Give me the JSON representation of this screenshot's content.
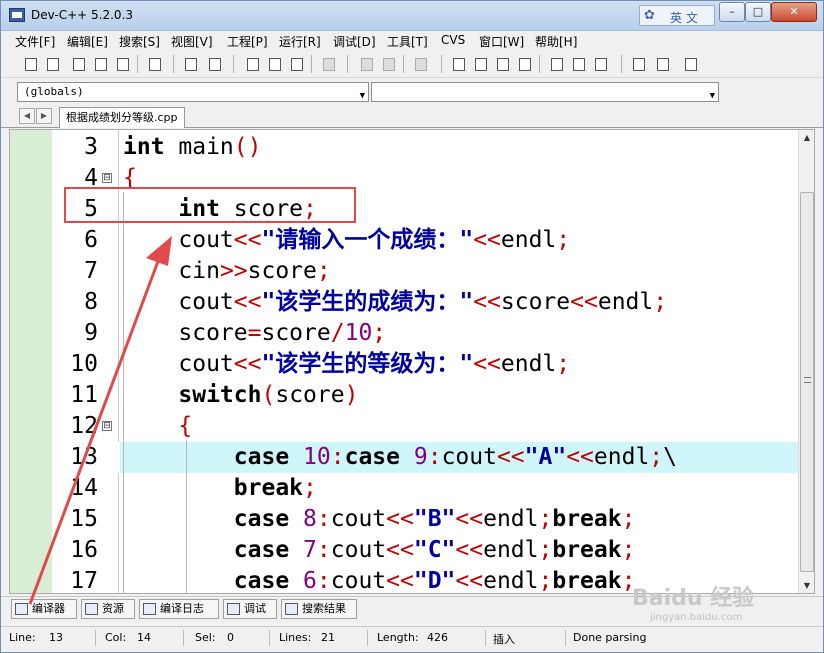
{
  "window": {
    "title": "Dev-C++ 5.2.0.3",
    "ime_label": "英 文",
    "controls": {
      "minimize": "–",
      "maximize": "□",
      "close": "✕"
    }
  },
  "menu": [
    "文件[F]",
    "编辑[E]",
    "搜索[S]",
    "视图[V]",
    "工程[P]",
    "运行[R]",
    "调试[D]",
    "工具[T]",
    "CVS",
    "窗口[W]",
    "帮助[H]"
  ],
  "toolbar": {
    "icons": [
      "new-file-icon",
      "open-file-icon",
      "save-icon",
      "save-all-icon",
      "close-file-icon",
      "print-icon",
      "undo-icon",
      "redo-icon",
      "find-icon",
      "replace-icon",
      "find-next-icon",
      "goto-line-icon",
      "add-to-project-icon",
      "remove-from-project-icon",
      "project-options-icon",
      "compile-icon",
      "run-icon",
      "compile-run-icon",
      "rebuild-icon",
      "syntax-check-icon",
      "profile-icon",
      "delete-profile-icon",
      "new-class-icon",
      "insert-icon",
      "toggle-bookmark-icon"
    ]
  },
  "combos": {
    "scope": "(globals)",
    "member": ""
  },
  "tabs": {
    "active_file": "根据成绩划分等级.cpp"
  },
  "editor": {
    "highlighted_line": "13",
    "lines": [
      {
        "num": "3",
        "fold": "",
        "code": [
          {
            "t": "int",
            "c": "kw"
          },
          {
            "t": " main",
            "c": ""
          },
          {
            "t": "()",
            "c": "op"
          }
        ]
      },
      {
        "num": "4",
        "fold": "⊟",
        "code": [
          {
            "t": "{",
            "c": "op"
          }
        ]
      },
      {
        "num": "5",
        "fold": "",
        "code": [
          {
            "t": "    ",
            "c": ""
          },
          {
            "t": "int",
            "c": "kw"
          },
          {
            "t": " score",
            "c": ""
          },
          {
            "t": ";",
            "c": "op"
          }
        ]
      },
      {
        "num": "6",
        "fold": "",
        "code": [
          {
            "t": "    cout",
            "c": ""
          },
          {
            "t": "<<",
            "c": "op"
          },
          {
            "t": "\"请输入一个成绩：\"",
            "c": "str"
          },
          {
            "t": "<<",
            "c": "op"
          },
          {
            "t": "endl",
            "c": ""
          },
          {
            "t": ";",
            "c": "op"
          }
        ]
      },
      {
        "num": "7",
        "fold": "",
        "code": [
          {
            "t": "    cin",
            "c": ""
          },
          {
            "t": ">>",
            "c": "op"
          },
          {
            "t": "score",
            "c": ""
          },
          {
            "t": ";",
            "c": "op"
          }
        ]
      },
      {
        "num": "8",
        "fold": "",
        "code": [
          {
            "t": "    cout",
            "c": ""
          },
          {
            "t": "<<",
            "c": "op"
          },
          {
            "t": "\"该学生的成绩为：\"",
            "c": "str"
          },
          {
            "t": "<<",
            "c": "op"
          },
          {
            "t": "score",
            "c": ""
          },
          {
            "t": "<<",
            "c": "op"
          },
          {
            "t": "endl",
            "c": ""
          },
          {
            "t": ";",
            "c": "op"
          }
        ]
      },
      {
        "num": "9",
        "fold": "",
        "code": [
          {
            "t": "    score",
            "c": ""
          },
          {
            "t": "=",
            "c": "op"
          },
          {
            "t": "score",
            "c": ""
          },
          {
            "t": "/",
            "c": "op"
          },
          {
            "t": "10",
            "c": "num"
          },
          {
            "t": ";",
            "c": "op"
          }
        ]
      },
      {
        "num": "10",
        "fold": "",
        "code": [
          {
            "t": "    cout",
            "c": ""
          },
          {
            "t": "<<",
            "c": "op"
          },
          {
            "t": "\"该学生的等级为：\"",
            "c": "str"
          },
          {
            "t": "<<",
            "c": "op"
          },
          {
            "t": "endl",
            "c": ""
          },
          {
            "t": ";",
            "c": "op"
          }
        ]
      },
      {
        "num": "11",
        "fold": "",
        "code": [
          {
            "t": "    ",
            "c": ""
          },
          {
            "t": "switch",
            "c": "kw"
          },
          {
            "t": "(",
            "c": "op"
          },
          {
            "t": "score",
            "c": ""
          },
          {
            "t": ")",
            "c": "op"
          }
        ]
      },
      {
        "num": "12",
        "fold": "⊟",
        "code": [
          {
            "t": "    ",
            "c": ""
          },
          {
            "t": "{",
            "c": "op"
          }
        ]
      },
      {
        "num": "13",
        "fold": "",
        "code": [
          {
            "t": "        ",
            "c": ""
          },
          {
            "t": "case",
            "c": "kw"
          },
          {
            "t": " ",
            "c": ""
          },
          {
            "t": "10",
            "c": "num"
          },
          {
            "t": ":",
            "c": "op"
          },
          {
            "t": "case",
            "c": "kw"
          },
          {
            "t": " ",
            "c": ""
          },
          {
            "t": "9",
            "c": "num"
          },
          {
            "t": ":",
            "c": "op"
          },
          {
            "t": "cout",
            "c": ""
          },
          {
            "t": "<<",
            "c": "op"
          },
          {
            "t": "\"A\"",
            "c": "str"
          },
          {
            "t": "<<",
            "c": "op"
          },
          {
            "t": "endl",
            "c": ""
          },
          {
            "t": ";",
            "c": "op"
          },
          {
            "t": "\\",
            "c": ""
          }
        ]
      },
      {
        "num": "14",
        "fold": "",
        "code": [
          {
            "t": "        ",
            "c": ""
          },
          {
            "t": "break",
            "c": "kw"
          },
          {
            "t": ";",
            "c": "op"
          }
        ]
      },
      {
        "num": "15",
        "fold": "",
        "code": [
          {
            "t": "        ",
            "c": ""
          },
          {
            "t": "case",
            "c": "kw"
          },
          {
            "t": " ",
            "c": ""
          },
          {
            "t": "8",
            "c": "num"
          },
          {
            "t": ":",
            "c": "op"
          },
          {
            "t": "cout",
            "c": ""
          },
          {
            "t": "<<",
            "c": "op"
          },
          {
            "t": "\"B\"",
            "c": "str"
          },
          {
            "t": "<<",
            "c": "op"
          },
          {
            "t": "endl",
            "c": ""
          },
          {
            "t": ";",
            "c": "op"
          },
          {
            "t": "break",
            "c": "kw"
          },
          {
            "t": ";",
            "c": "op"
          }
        ]
      },
      {
        "num": "16",
        "fold": "",
        "code": [
          {
            "t": "        ",
            "c": ""
          },
          {
            "t": "case",
            "c": "kw"
          },
          {
            "t": " ",
            "c": ""
          },
          {
            "t": "7",
            "c": "num"
          },
          {
            "t": ":",
            "c": "op"
          },
          {
            "t": "cout",
            "c": ""
          },
          {
            "t": "<<",
            "c": "op"
          },
          {
            "t": "\"C\"",
            "c": "str"
          },
          {
            "t": "<<",
            "c": "op"
          },
          {
            "t": "endl",
            "c": ""
          },
          {
            "t": ";",
            "c": "op"
          },
          {
            "t": "break",
            "c": "kw"
          },
          {
            "t": ";",
            "c": "op"
          }
        ]
      },
      {
        "num": "17",
        "fold": "",
        "code": [
          {
            "t": "        ",
            "c": ""
          },
          {
            "t": "case",
            "c": "kw"
          },
          {
            "t": " ",
            "c": ""
          },
          {
            "t": "6",
            "c": "num"
          },
          {
            "t": ":",
            "c": "op"
          },
          {
            "t": "cout",
            "c": ""
          },
          {
            "t": "<<",
            "c": "op"
          },
          {
            "t": "\"D\"",
            "c": "str"
          },
          {
            "t": "<<",
            "c": "op"
          },
          {
            "t": "endl",
            "c": ""
          },
          {
            "t": ";",
            "c": "op"
          },
          {
            "t": "break",
            "c": "kw"
          },
          {
            "t": ";",
            "c": "op"
          }
        ]
      }
    ]
  },
  "bottom_tabs": [
    "编译器",
    "资源",
    "编译日志",
    "调试",
    "搜索结果"
  ],
  "status": {
    "line_label": "Line:",
    "line": "13",
    "col_label": "Col:",
    "col": "14",
    "sel_label": "Sel:",
    "sel": "0",
    "lines_label": "Lines:",
    "lines": "21",
    "length_label": "Length:",
    "length": "426",
    "mode": "插入",
    "message": "Done parsing"
  },
  "watermark": {
    "text": "Baidu 经验",
    "sub": "jingyan.baidu.com"
  },
  "colors": {
    "annotation": "#e04a4a",
    "highlight_line": "#cff6fb",
    "operator": "#c00000",
    "string": "#0000a0",
    "number": "#800080",
    "margin": "#d7eed5"
  }
}
